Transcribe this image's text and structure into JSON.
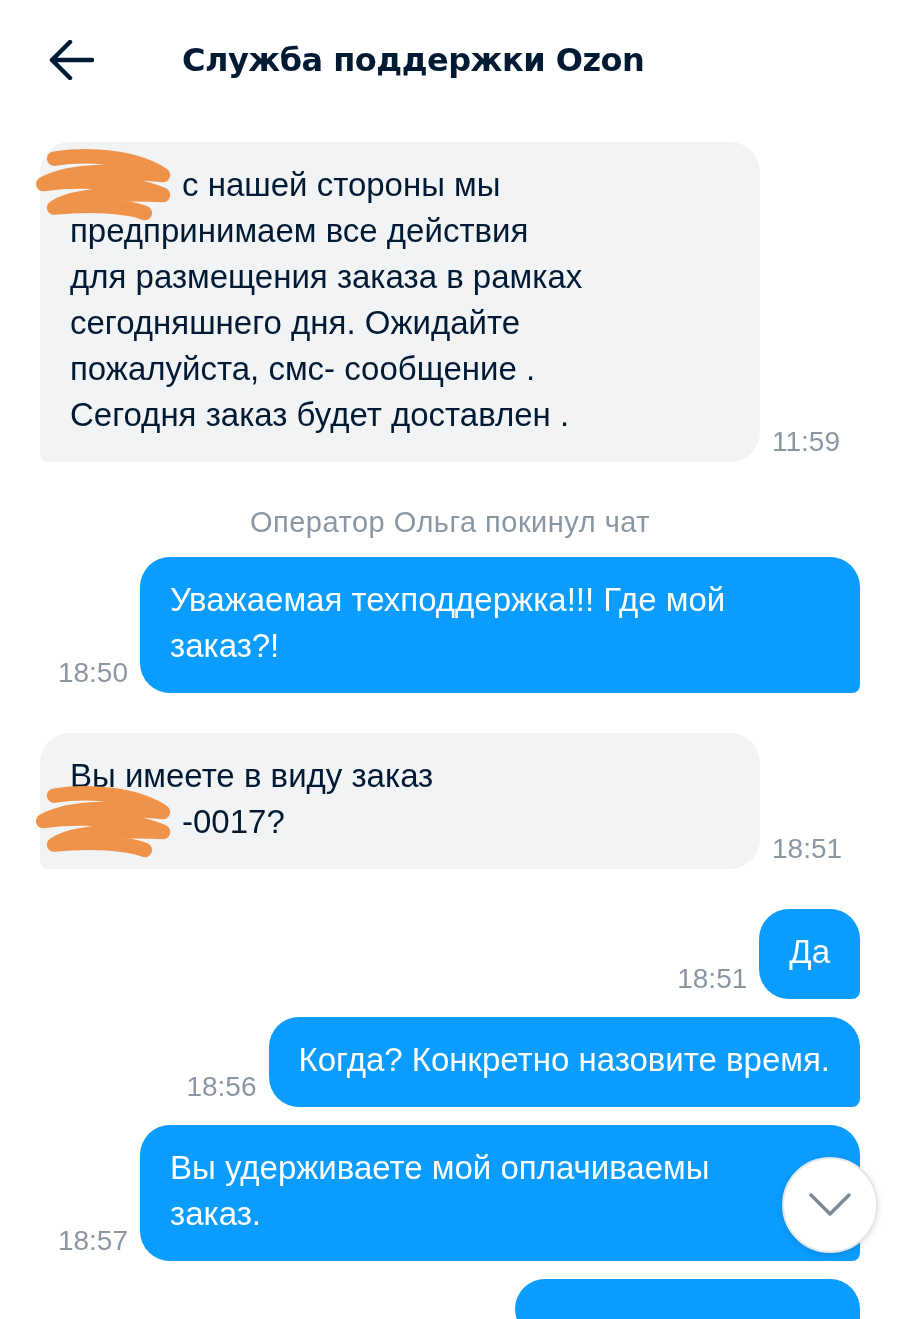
{
  "header": {
    "title": "Служба поддержки Ozon"
  },
  "messages": [
    {
      "kind": "message",
      "outgoing": false,
      "time": "11:59",
      "lines": [
        {
          "text": "с нашей стороны мы",
          "redacted": true
        },
        {
          "text": "предпринимаем все действия",
          "redacted": false
        },
        {
          "text": "для размещения заказа в рамках",
          "redacted": false
        },
        {
          "text": "сегодняшнего дня. Ожидайте",
          "redacted": false
        },
        {
          "text": "пожалуйста, смс- сообщение .",
          "redacted": false
        },
        {
          "text": "Сегодня заказ будет доставлен .",
          "redacted": false
        }
      ]
    },
    {
      "kind": "system",
      "text": "Оператор Ольга покинул чат"
    },
    {
      "kind": "message",
      "outgoing": true,
      "time": "18:50",
      "lines": [
        {
          "text": "Уважаемая техподдержка!!! Где мой",
          "redacted": false
        },
        {
          "text": "заказ?!",
          "redacted": false
        }
      ]
    },
    {
      "kind": "message",
      "outgoing": false,
      "time": "18:51",
      "lines": [
        {
          "text": "Вы имеете в виду заказ",
          "redacted": false
        },
        {
          "text": "-0017?",
          "redacted": true
        }
      ]
    },
    {
      "kind": "message",
      "outgoing": true,
      "time": "18:51",
      "lines": [
        {
          "text": "Да",
          "redacted": false
        }
      ]
    },
    {
      "kind": "message",
      "outgoing": true,
      "time": "18:56",
      "lines": [
        {
          "text": "Когда? Конкретно назовите время.",
          "redacted": false
        }
      ]
    },
    {
      "kind": "message",
      "outgoing": true,
      "time": "18:57",
      "lines": [
        {
          "text": "Вы удерживаете мой оплачиваемы",
          "redacted": false
        },
        {
          "text": "заказ.",
          "redacted": false
        }
      ]
    },
    {
      "kind": "cut",
      "outgoing": true
    }
  ]
}
